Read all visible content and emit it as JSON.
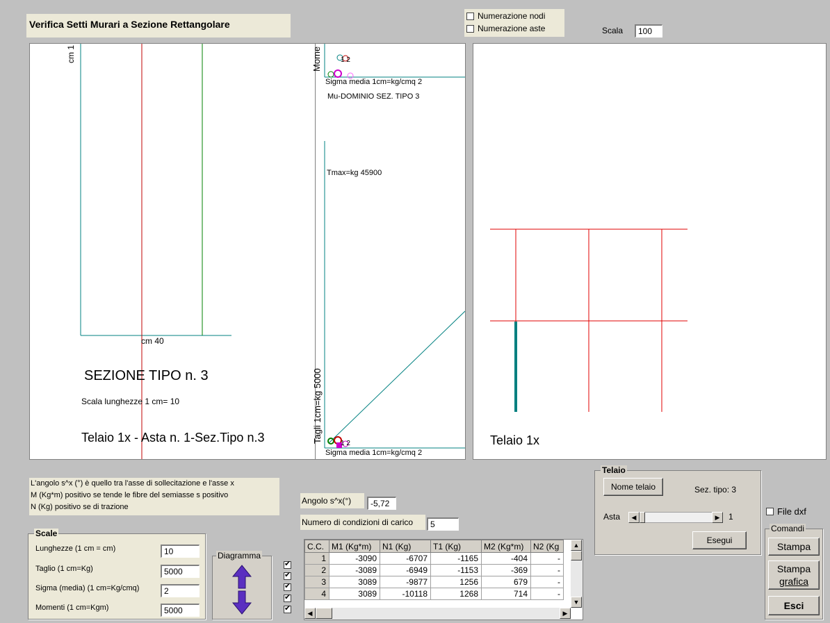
{
  "window": {
    "title": "Verifica Setti Murari a Sezione Rettangolare"
  },
  "options": {
    "nodes_label": "Numerazione nodi",
    "bars_label": "Numerazione aste",
    "scale_label": "Scala",
    "scale_value": "100"
  },
  "section_view": {
    "y_label": "cm 1",
    "x_label": "cm 40",
    "section_title": "SEZIONE TIPO n.  3",
    "length_scale": "Scala lunghezze 1 cm=  10",
    "caption": "Telaio 1x - Asta n. 1-Sez.Tipo n.3"
  },
  "diagram_view": {
    "moment_axis": "Mome",
    "sigma_top": "Sigma media 1cm=kg/cmq  2",
    "mu_label": "Mu-DOMINIO SEZ. TIPO   3",
    "tmax": "Tmax=kg  45900",
    "shear_axis": "Tagli 1cm=kg  5000",
    "sigma_bottom": "Sigma media 1cm=kg/cmq  2",
    "marker_top": "1 2",
    "marker_bottom": "1 2"
  },
  "frame_view": {
    "caption": "Telaio 1x"
  },
  "notes": [
    "L'angolo s^x (°) è quello tra l'asse di sollecitazione e l'asse x",
    "M (Kg*m) positivo se tende le fibre del semiasse s positivo",
    "N (Kg) positivo se di trazione"
  ],
  "scale_group": {
    "title": "Scale",
    "rows": [
      {
        "label": "Lunghezze (1 cm = cm)",
        "value": "10"
      },
      {
        "label": "Taglio (1 cm=Kg)",
        "value": "5000"
      },
      {
        "label": "Sigma (media) (1 cm=Kg/cmq)",
        "value": "2"
      },
      {
        "label": "Momenti (1 cm=Kgm)",
        "value": "5000"
      }
    ]
  },
  "diagram_group": {
    "title": "Diagramma"
  },
  "angle": {
    "label": "Angolo s^x(°)",
    "value": "-5,72"
  },
  "load_conditions": {
    "label": "Numero di condizioni di carico",
    "value": "5"
  },
  "table": {
    "headers": [
      "C.C.",
      "M1 (Kg*m)",
      "N1 (Kg)",
      "T1 (Kg)",
      "M2 (Kg*m)",
      "N2 (Kg"
    ],
    "rows": [
      [
        "1",
        "-3090",
        "-6707",
        "-1165",
        "-404",
        "-"
      ],
      [
        "2",
        "-3089",
        "-6949",
        "-1153",
        "-369",
        "-"
      ],
      [
        "3",
        "3089",
        "-9877",
        "1256",
        "679",
        "-"
      ],
      [
        "4",
        "3089",
        "-10118",
        "1268",
        "714",
        "-"
      ]
    ]
  },
  "telaio_group": {
    "title": "Telaio",
    "name_button": "Nome telaio",
    "section_type": "Sez. tipo: 3",
    "asta_label": "Asta",
    "asta_value": "1",
    "run_button": "Esegui"
  },
  "dxf_label": "File dxf",
  "commands": {
    "title": "Comandi",
    "print": "Stampa",
    "print_graphic_1": "Stampa",
    "print_graphic_2": "grafica",
    "exit": "Esci"
  },
  "colors": {
    "teal": "#008080",
    "red": "#c00000",
    "green": "#008000",
    "frame_red": "#e00000"
  }
}
